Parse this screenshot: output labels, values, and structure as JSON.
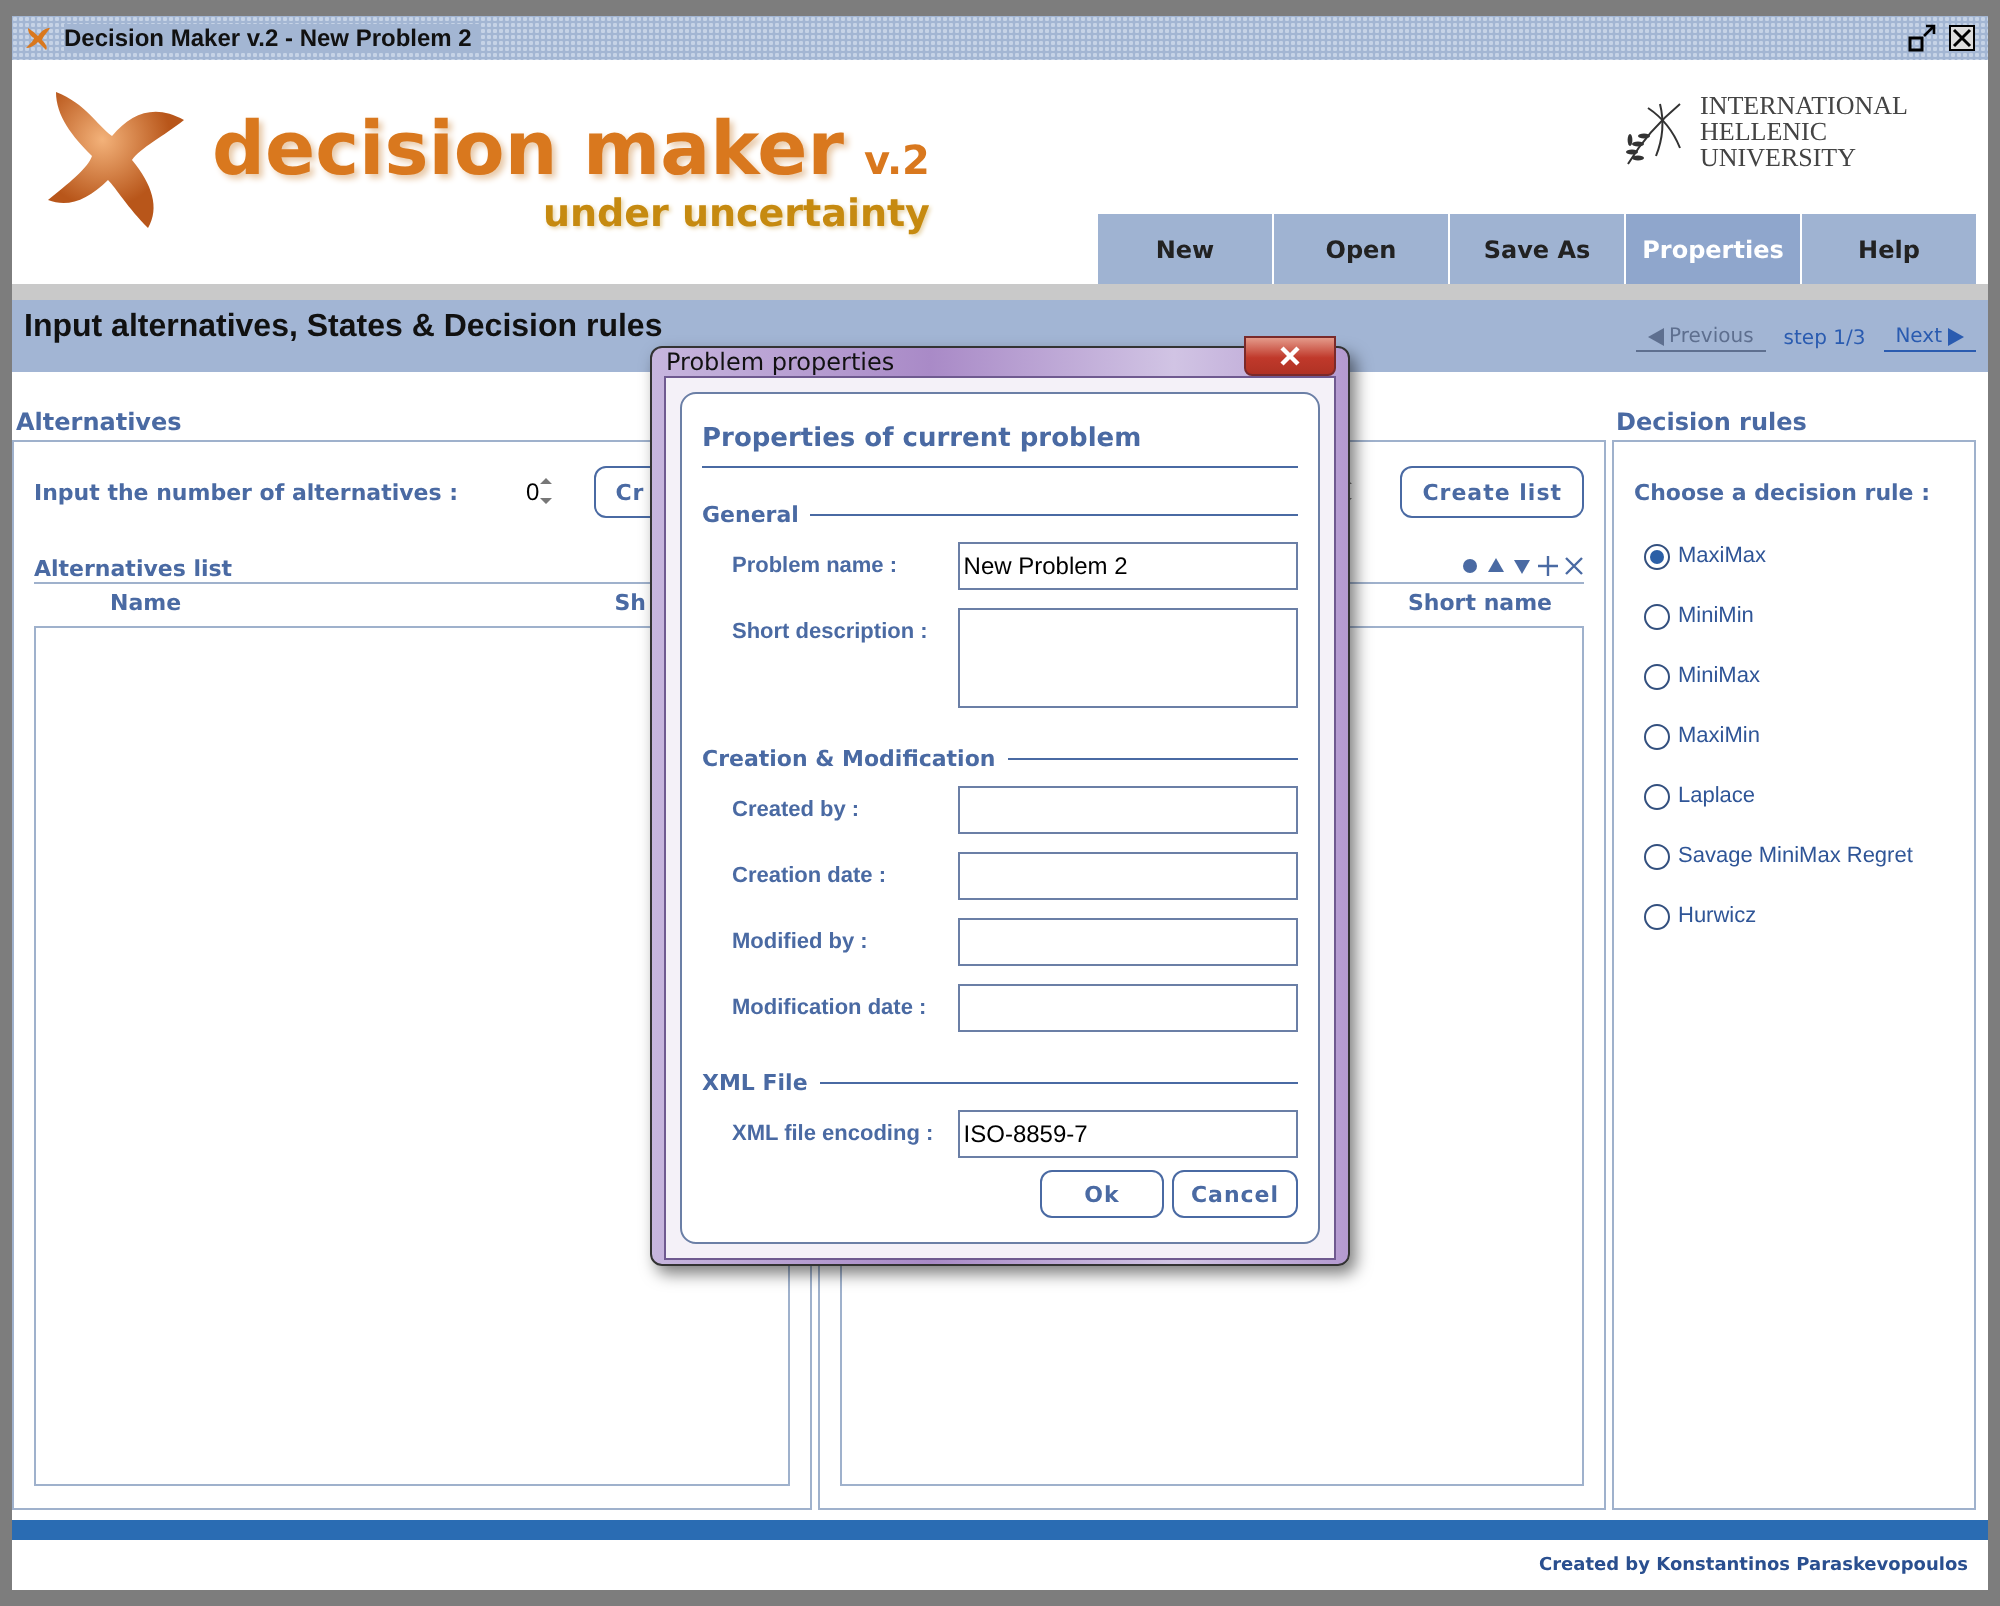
{
  "window": {
    "title": "Decision Maker v.2 - New Problem 2"
  },
  "banner": {
    "logo_text": "decision maker",
    "version": "v.2",
    "tagline": "under uncertainty",
    "university": [
      "INTERNATIONAL",
      "HELLENIC",
      "UNIVERSITY"
    ]
  },
  "nav": [
    {
      "label": "New",
      "selected": false
    },
    {
      "label": "Open",
      "selected": false
    },
    {
      "label": "Save As",
      "selected": false
    },
    {
      "label": "Properties",
      "selected": true
    },
    {
      "label": "Help",
      "selected": false
    }
  ],
  "step_header": {
    "title": "Input alternatives, States & Decision rules",
    "previous": {
      "label": "Previous",
      "disabled": true
    },
    "step": "step 1/3",
    "next": {
      "label": "Next",
      "disabled": false
    }
  },
  "alternatives": {
    "heading": "Alternatives",
    "count_label": "Input the number of alternatives :",
    "count": "0",
    "create_button": "Cr",
    "list_label": "Alternatives list",
    "columns": [
      "Name",
      "Sh"
    ]
  },
  "states": {
    "create_button": "Create list",
    "toolbar": [
      {
        "kind": "dot"
      },
      {
        "kind": "up"
      },
      {
        "kind": "down"
      },
      {
        "kind": "add"
      },
      {
        "kind": "remove"
      }
    ],
    "columns": [
      "Short name"
    ]
  },
  "decision_rules": {
    "heading": "Decision rules",
    "prompt": "Choose a decision rule :",
    "options": [
      {
        "label": "MaxiMax",
        "selected": true
      },
      {
        "label": "MiniMin",
        "selected": false
      },
      {
        "label": "MiniMax",
        "selected": false
      },
      {
        "label": "MaxiMin",
        "selected": false
      },
      {
        "label": "Laplace",
        "selected": false
      },
      {
        "label": "Savage MiniMax Regret",
        "selected": false
      },
      {
        "label": "Hurwicz",
        "selected": false
      }
    ]
  },
  "dialog": {
    "title": "Problem properties",
    "heading": "Properties of current problem",
    "sections": [
      {
        "title": "General",
        "fields": [
          {
            "label": "Problem name :",
            "value": "New Problem 2",
            "kind": "line"
          },
          {
            "label": "Short description :",
            "kind": "area"
          }
        ]
      },
      {
        "title": "Creation & Modification",
        "fields": [
          {
            "label": "Created by :",
            "kind": "line"
          },
          {
            "label": "Creation date :",
            "kind": "line"
          },
          {
            "label": "Modified by :",
            "kind": "line"
          },
          {
            "label": "Modification date :",
            "kind": "line"
          }
        ]
      },
      {
        "title": "XML File",
        "fields": [
          {
            "label": "XML file encoding :",
            "value": "ISO-8859-7",
            "kind": "line"
          }
        ]
      }
    ],
    "buttons": [
      "Ok",
      "Cancel"
    ]
  },
  "footer": {
    "credit": "Created by Konstantinos Paraskevopoulos"
  }
}
